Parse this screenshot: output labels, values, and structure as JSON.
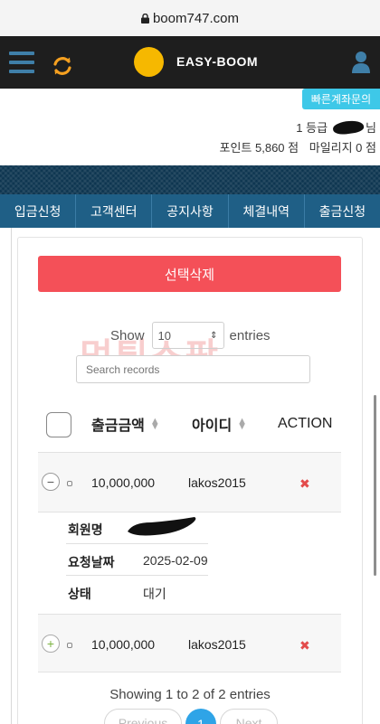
{
  "browser": {
    "url": "boom747.com"
  },
  "header": {
    "brand": "EASY-BOOM",
    "quick_inquiry_label": "빠른계좌문의",
    "grade": "1 등급",
    "user_suffix": "님",
    "points": "포인트 5,860 점",
    "mileage": "마일리지 0 점"
  },
  "nav": {
    "items": [
      "입금신청",
      "고객센터",
      "공지사항",
      "체결내역",
      "출금신청"
    ]
  },
  "table": {
    "delete_button": "선택삭제",
    "show_label": "Show",
    "entries_label": "entries",
    "page_size": "10",
    "search_placeholder": "Search records",
    "columns": {
      "amount": "출금금액",
      "id": "아이디",
      "action": "ACTION"
    },
    "rows": [
      {
        "amount": "10,000,000",
        "id": "lakos2015",
        "expanded": true,
        "details": {
          "member_label": "회원명",
          "date_label": "요청날짜",
          "date": "2025-02-09",
          "status_label": "상태",
          "status": "대기"
        }
      },
      {
        "amount": "10,000,000",
        "id": "lakos2015",
        "expanded": false
      }
    ],
    "info": "Showing 1 to 2 of 2 entries",
    "pagination": {
      "previous": "Previous",
      "current": "1",
      "next": "Next"
    }
  },
  "watermark": "먹튀스팟",
  "colors": {
    "accent_red": "#f45058",
    "nav_blue": "#1f5f86",
    "quick_cyan": "#3ec8e8",
    "logo_yellow": "#f6b800",
    "page_blue": "#2fa4e7"
  }
}
